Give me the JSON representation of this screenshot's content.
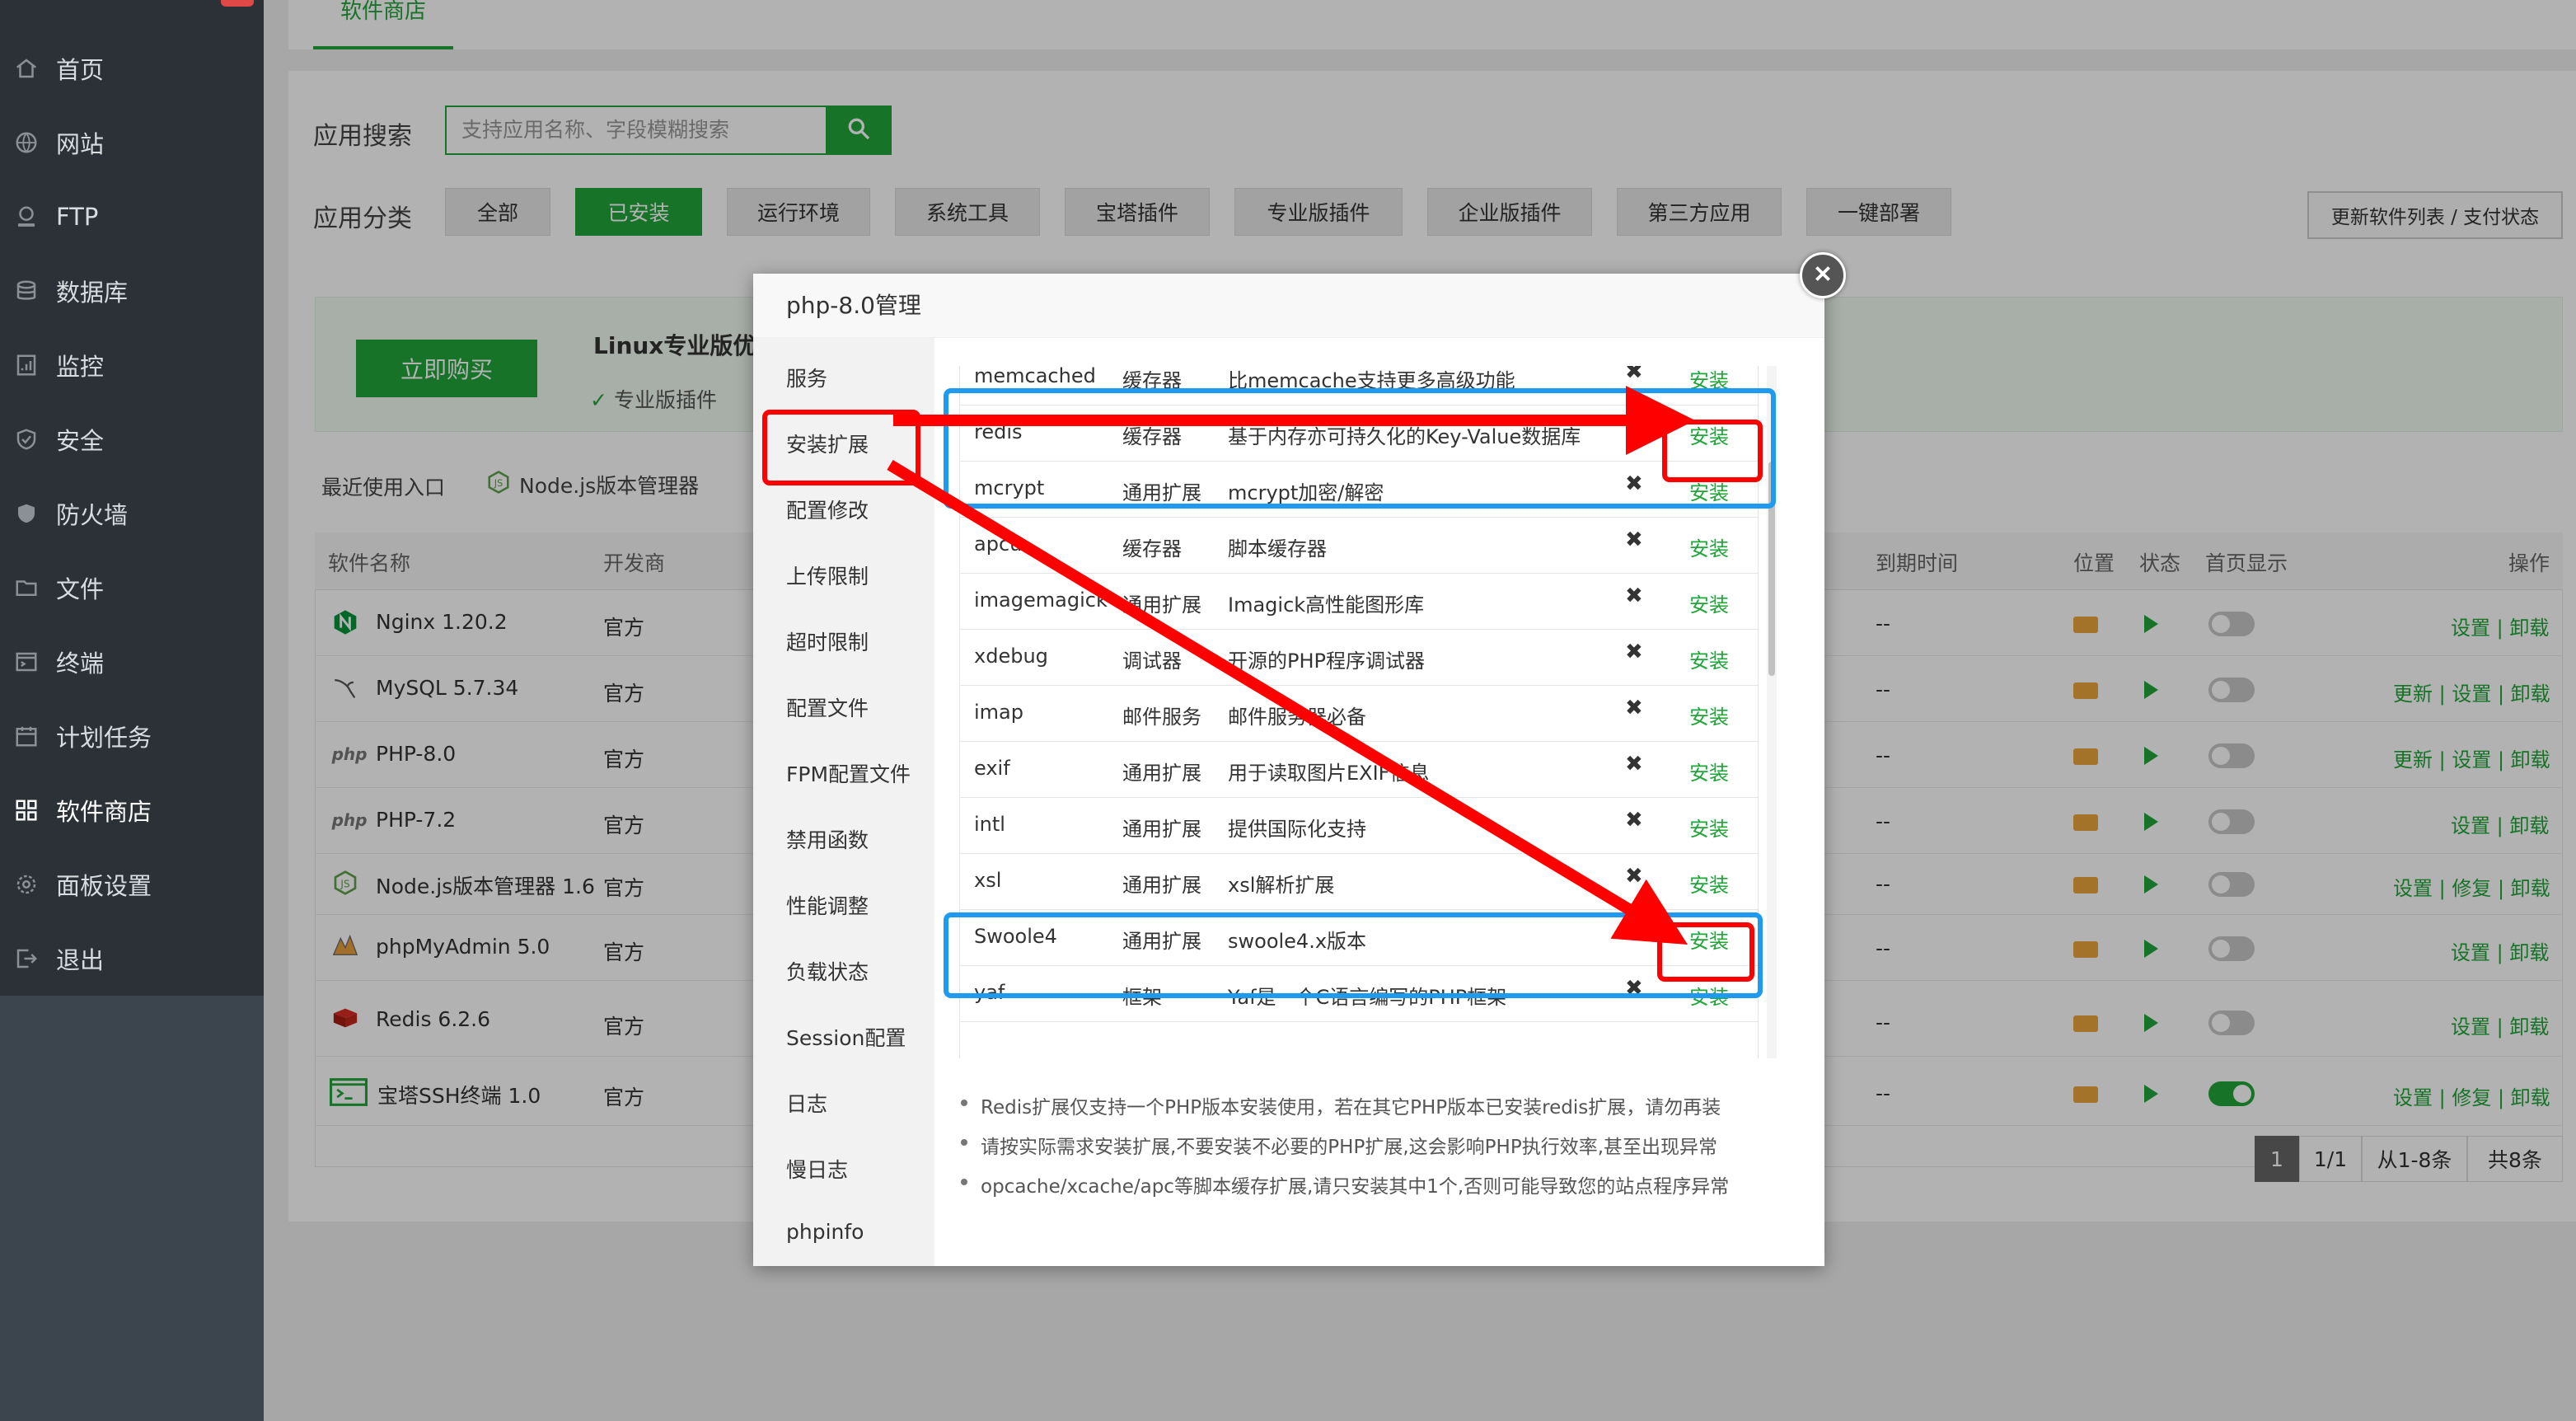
{
  "sidebar": {
    "items": [
      {
        "label": "首页",
        "icon": "home-icon"
      },
      {
        "label": "网站",
        "icon": "globe-icon"
      },
      {
        "label": "FTP",
        "icon": "ftp-icon"
      },
      {
        "label": "数据库",
        "icon": "database-icon"
      },
      {
        "label": "监控",
        "icon": "monitor-icon"
      },
      {
        "label": "安全",
        "icon": "shield-icon"
      },
      {
        "label": "防火墙",
        "icon": "firewall-icon"
      },
      {
        "label": "文件",
        "icon": "folder-icon"
      },
      {
        "label": "终端",
        "icon": "terminal-icon"
      },
      {
        "label": "计划任务",
        "icon": "calendar-icon"
      },
      {
        "label": "软件商店",
        "icon": "grid-icon",
        "active": true
      },
      {
        "label": "面板设置",
        "icon": "gear-icon"
      },
      {
        "label": "退出",
        "icon": "logout-icon"
      }
    ]
  },
  "tabs": {
    "active": "软件商店"
  },
  "search": {
    "label": "应用搜索",
    "placeholder": "支持应用名称、字段模糊搜索"
  },
  "categories": {
    "label": "应用分类",
    "items": [
      "全部",
      "已安装",
      "运行环境",
      "系统工具",
      "宝塔插件",
      "专业版插件",
      "企业版插件",
      "第三方应用",
      "一键部署"
    ],
    "active": "已安装"
  },
  "update_button": "更新软件列表 / 支付状态",
  "promo": {
    "buy": "立即购买",
    "title": "Linux专业版优惠",
    "subtitle": "专业版插件"
  },
  "recent": {
    "label": "最近使用入口",
    "item": "Node.js版本管理器"
  },
  "table": {
    "headers": {
      "name": "软件名称",
      "developer": "开发商",
      "expire": "到期时间",
      "location": "位置",
      "status": "状态",
      "homepage": "首页显示",
      "ops": "操作"
    },
    "rows": [
      {
        "name": "Nginx 1.20.2",
        "dev": "官方",
        "expire": "--",
        "ops": "设置 | 卸载",
        "home": false,
        "icon": "nginx-icon"
      },
      {
        "name": "MySQL 5.7.34",
        "dev": "官方",
        "expire": "--",
        "ops": "更新 | 设置 | 卸载",
        "home": false,
        "icon": "mysql-icon"
      },
      {
        "name": "PHP-8.0",
        "dev": "官方",
        "expire": "--",
        "ops": "更新 | 设置 | 卸载",
        "home": false,
        "icon": "php-icon"
      },
      {
        "name": "PHP-7.2",
        "dev": "官方",
        "expire": "--",
        "ops": "设置 | 卸载",
        "home": false,
        "icon": "php-icon"
      },
      {
        "name": "Node.js版本管理器 1.6",
        "dev": "官方",
        "expire": "--",
        "ops": "设置 | 修复 | 卸载",
        "home": false,
        "icon": "nodejs-icon"
      },
      {
        "name": "phpMyAdmin 5.0",
        "dev": "官方",
        "expire": "--",
        "ops": "设置 | 卸载",
        "home": false,
        "icon": "phpmyadmin-icon"
      },
      {
        "name": "Redis 6.2.6",
        "dev": "官方",
        "expire": "--",
        "ops": "设置 | 卸载",
        "home": false,
        "icon": "redis-icon"
      },
      {
        "name": "宝塔SSH终端 1.0",
        "dev": "官方",
        "expire": "--",
        "ops": "设置 | 修复 | 卸载",
        "home": true,
        "icon": "ssh-terminal-icon"
      }
    ]
  },
  "pagination": {
    "current": "1",
    "pages": "1/1",
    "range": "从1-8条",
    "total": "共8条"
  },
  "modal": {
    "title": "php-8.0管理",
    "nav": [
      "服务",
      "安装扩展",
      "配置修改",
      "上传限制",
      "超时限制",
      "配置文件",
      "FPM配置文件",
      "禁用函数",
      "性能调整",
      "负载状态",
      "Session配置",
      "日志",
      "慢日志",
      "phpinfo"
    ],
    "active_nav": "安装扩展",
    "extensions": [
      {
        "name": "memcached",
        "type": "缓存器",
        "desc": "比memcache支持更多高级功能",
        "action": "安装"
      },
      {
        "name": "redis",
        "type": "缓存器",
        "desc": "基于内存亦可持久化的Key-Value数据库",
        "action": "安装"
      },
      {
        "name": "mcrypt",
        "type": "通用扩展",
        "desc": "mcrypt加密/解密",
        "action": "安装"
      },
      {
        "name": "apcu",
        "type": "缓存器",
        "desc": "脚本缓存器",
        "action": "安装"
      },
      {
        "name": "imagemagick",
        "type": "通用扩展",
        "desc": "Imagick高性能图形库",
        "action": "安装"
      },
      {
        "name": "xdebug",
        "type": "调试器",
        "desc": "开源的PHP程序调试器",
        "action": "安装"
      },
      {
        "name": "imap",
        "type": "邮件服务",
        "desc": "邮件服务器必备",
        "action": "安装"
      },
      {
        "name": "exif",
        "type": "通用扩展",
        "desc": "用于读取图片EXIF信息",
        "action": "安装"
      },
      {
        "name": "intl",
        "type": "通用扩展",
        "desc": "提供国际化支持",
        "action": "安装"
      },
      {
        "name": "xsl",
        "type": "通用扩展",
        "desc": "xsl解析扩展",
        "action": "安装"
      },
      {
        "name": "Swoole4",
        "type": "通用扩展",
        "desc": "swoole4.x版本",
        "action": "安装"
      },
      {
        "name": "yaf",
        "type": "框架",
        "desc": "Yaf是一个C语言编写的PHP框架",
        "action": "安装"
      }
    ],
    "notes": [
      "Redis扩展仅支持一个PHP版本安装使用，若在其它PHP版本已安装redis扩展，请勿再装",
      "请按实际需求安装扩展,不要安装不必要的PHP扩展,这会影响PHP执行效率,甚至出现异常",
      "opcache/xcache/apc等脚本缓存扩展,请只安装其中1个,否则可能导致您的站点程序异常"
    ]
  },
  "colors": {
    "accent": "#20a53a",
    "annotation_red": "#ff0000",
    "annotation_blue": "#1e9bf0",
    "sidebar_bg": "#2c3138"
  }
}
